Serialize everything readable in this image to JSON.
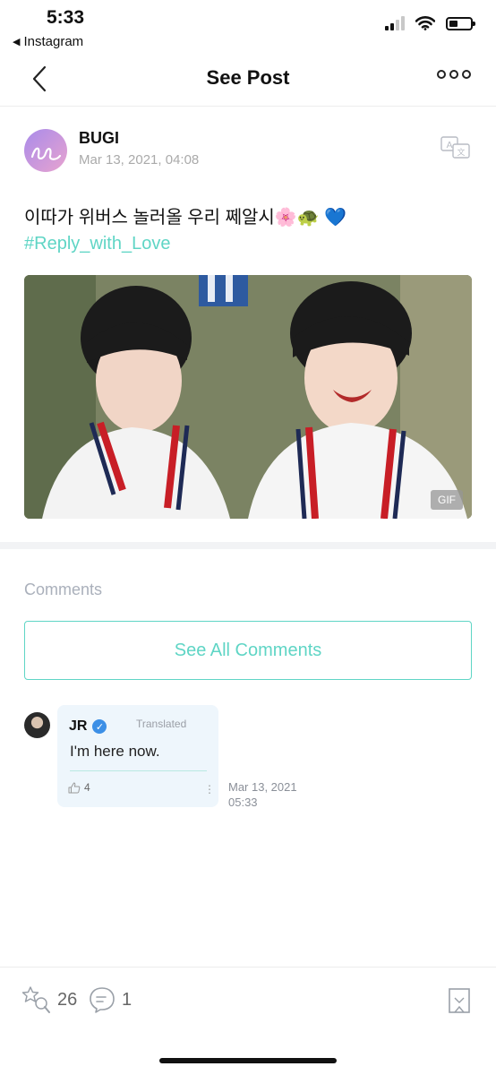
{
  "status_bar": {
    "time": "5:33",
    "back_app": "Instagram"
  },
  "header": {
    "title": "See Post"
  },
  "post": {
    "author": "BUGI",
    "date": "Mar 13, 2021, 04:08",
    "text": "이따가 위버스 놀러올 우리 쩨알시🌸🐢 💙",
    "hashtag": "#Reply_with_Love",
    "media_badge": "GIF"
  },
  "comments": {
    "section_label": "Comments",
    "see_all_label": "See All Comments",
    "items": [
      {
        "author": "JR",
        "verified": true,
        "translated_label": "Translated",
        "text": "I'm here now.",
        "likes": "4",
        "date": "Mar 13, 2021",
        "time": "05:33"
      }
    ]
  },
  "footer": {
    "reactions": "26",
    "comments": "1"
  },
  "colors": {
    "accent": "#5fd5c5",
    "verified": "#3c8fe6"
  }
}
